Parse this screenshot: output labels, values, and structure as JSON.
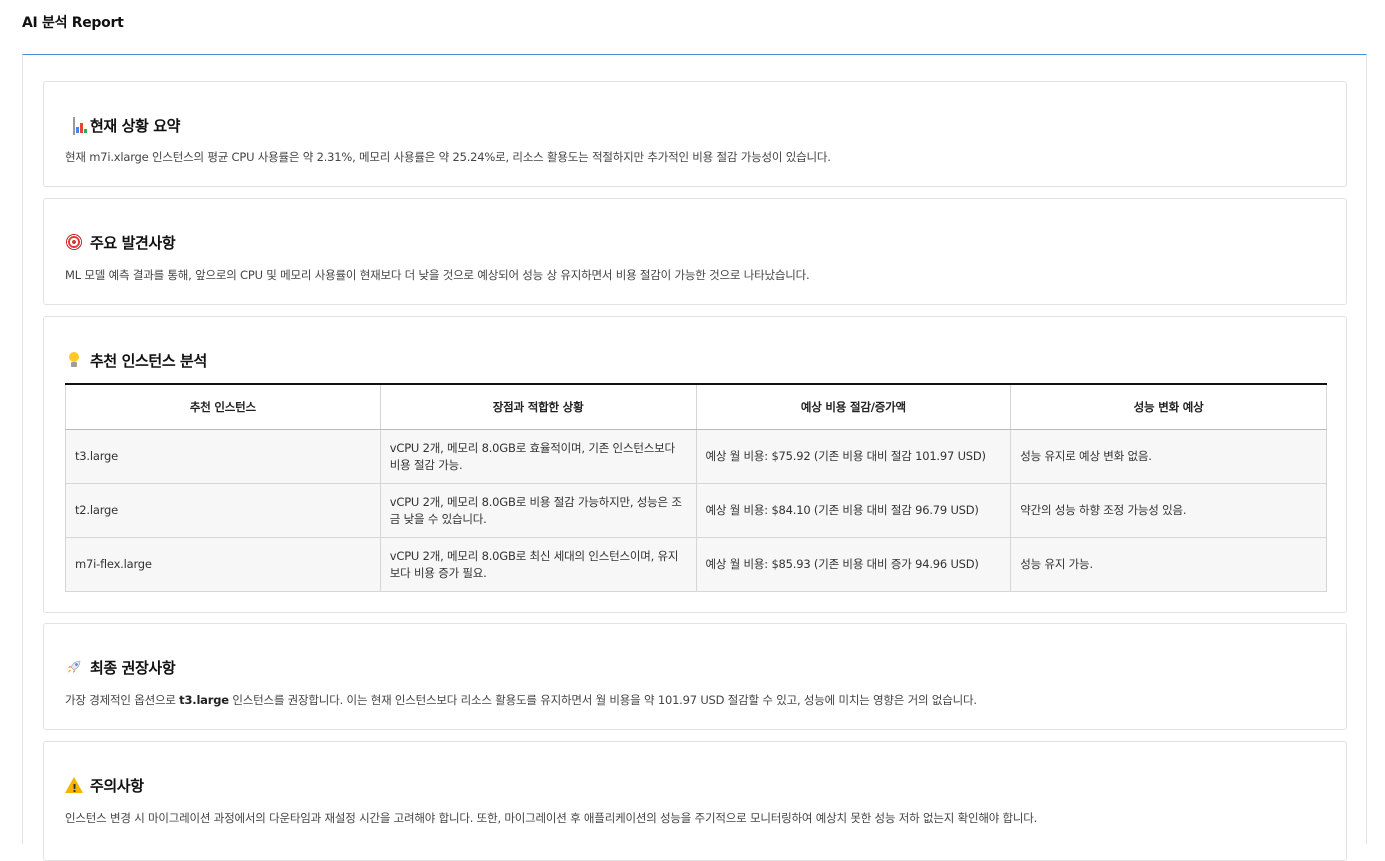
{
  "page": {
    "title": "AI 분석 Report"
  },
  "colors": {
    "accent_border": "#4a90d9",
    "warning": "#f4b400",
    "target": "#e53935"
  },
  "sections": {
    "summary": {
      "icon": "bar-chart-icon",
      "title": "현재 상황 요약",
      "text": "현재 m7i.xlarge 인스턴스의 평균 CPU 사용률은 약 2.31%, 메모리 사용률은 약 25.24%로, 리소스 활용도는 적절하지만 추가적인 비용 절감 가능성이 있습니다."
    },
    "findings": {
      "icon": "target-icon",
      "title": "주요 발견사항",
      "text": "ML 모델 예측 결과를 통해, 앞으로의 CPU 및 메모리 사용률이 현재보다 더 낮을 것으로 예상되어 성능 상 유지하면서 비용 절감이 가능한 것으로 나타났습니다."
    },
    "recommend": {
      "icon": "lightbulb-icon",
      "title": "추천 인스턴스 분석",
      "table": {
        "headers": [
          "추천 인스턴스",
          "장점과 적합한 상황",
          "예상 비용 절감/증가액",
          "성능 변화 예상"
        ],
        "rows": [
          [
            "t3.large",
            "vCPU 2개, 메모리 8.0GB로 효율적이며, 기존 인스턴스보다 비용 절감 가능.",
            "예상 월 비용: $75.92 (기존 비용 대비 절감 101.97 USD)",
            "성능 유지로 예상 변화 없음."
          ],
          [
            "t2.large",
            "vCPU 2개, 메모리 8.0GB로 비용 절감 가능하지만, 성능은 조금 낮을 수 있습니다.",
            "예상 월 비용: $84.10 (기존 비용 대비 절감 96.79 USD)",
            "약간의 성능 하향 조정 가능성 있음."
          ],
          [
            "m7i-flex.large",
            "vCPU 2개, 메모리 8.0GB로 최신 세대의 인스턴스이며, 유지 보다 비용 증가 필요.",
            "예상 월 비용: $85.93 (기존 비용 대비 증가 94.96 USD)",
            "성능 유지 가능."
          ]
        ]
      }
    },
    "final": {
      "icon": "rocket-icon",
      "title": "최종 권장사항",
      "text_before": "가장 경제적인 옵션으로 ",
      "text_bold": "t3.large",
      "text_after": " 인스턴스를 권장합니다. 이는 현재 인스턴스보다 리소스 활용도를 유지하면서 월 비용을 약 101.97 USD 절감할 수 있고, 성능에 미치는 영향은 거의 없습니다."
    },
    "caution": {
      "icon": "warning-icon",
      "title": "주의사항",
      "text": "인스턴스 변경 시 마이그레이션 과정에서의 다운타임과 재설정 시간을 고려해야 합니다. 또한, 마이그레이션 후 애플리케이션의 성능을 주기적으로 모니터링하여 예상치 못한 성능 저하 없는지 확인해야 합니다."
    }
  }
}
